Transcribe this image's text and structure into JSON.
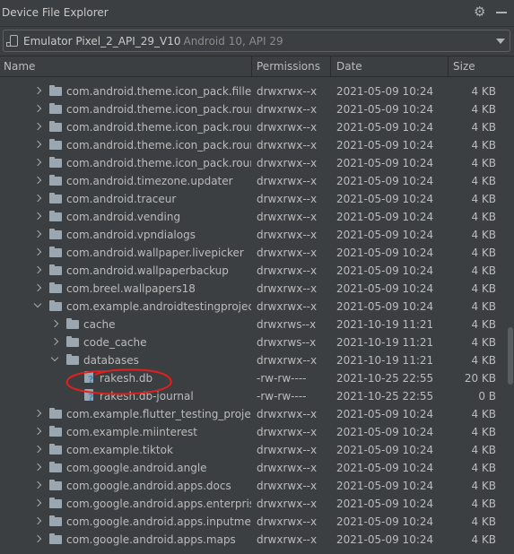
{
  "title": "Device File Explorer",
  "icons": {
    "settings": "gear-icon",
    "hide": "minimize-icon",
    "device": "phone-icon",
    "dropdown": "chevron-down-icon"
  },
  "device": {
    "name": "Emulator Pixel_2_API_29_V10",
    "detail": "Android 10, API 29"
  },
  "columns": {
    "name": "Name",
    "permissions": "Permissions",
    "date": "Date",
    "size": "Size"
  },
  "colors": {
    "annotation": "#e0201f",
    "folder": "#9aa7b0",
    "question_badge": "#3592c4"
  },
  "rows": [
    {
      "name": "com.android.theme.icon_pack.filled.themepicker",
      "perm": "drwxrwx--x",
      "date": "2021-05-09 10:24",
      "size": "4 KB",
      "depth": 0,
      "type": "folder",
      "state": "collapsed"
    },
    {
      "name": "com.android.theme.icon_pack.rounded.android",
      "perm": "drwxrwx--x",
      "date": "2021-05-09 10:24",
      "size": "4 KB",
      "depth": 0,
      "type": "folder",
      "state": "collapsed"
    },
    {
      "name": "com.android.theme.icon_pack.rounded.launcher",
      "perm": "drwxrwx--x",
      "date": "2021-05-09 10:24",
      "size": "4 KB",
      "depth": 0,
      "type": "folder",
      "state": "collapsed"
    },
    {
      "name": "com.android.theme.icon_pack.rounded.settings",
      "perm": "drwxrwx--x",
      "date": "2021-05-09 10:24",
      "size": "4 KB",
      "depth": 0,
      "type": "folder",
      "state": "collapsed"
    },
    {
      "name": "com.android.theme.icon_pack.rounded.systemui",
      "perm": "drwxrwx--x",
      "date": "2021-05-09 10:24",
      "size": "4 KB",
      "depth": 0,
      "type": "folder",
      "state": "collapsed"
    },
    {
      "name": "com.android.timezone.updater",
      "perm": "drwxrwx--x",
      "date": "2021-05-09 10:24",
      "size": "4 KB",
      "depth": 0,
      "type": "folder",
      "state": "collapsed"
    },
    {
      "name": "com.android.traceur",
      "perm": "drwxrwx--x",
      "date": "2021-05-09 10:24",
      "size": "4 KB",
      "depth": 0,
      "type": "folder",
      "state": "collapsed"
    },
    {
      "name": "com.android.vending",
      "perm": "drwxrwx--x",
      "date": "2021-05-09 10:24",
      "size": "4 KB",
      "depth": 0,
      "type": "folder",
      "state": "collapsed"
    },
    {
      "name": "com.android.vpndialogs",
      "perm": "drwxrwx--x",
      "date": "2021-05-09 10:24",
      "size": "4 KB",
      "depth": 0,
      "type": "folder",
      "state": "collapsed"
    },
    {
      "name": "com.android.wallpaper.livepicker",
      "perm": "drwxrwx--x",
      "date": "2021-05-09 10:24",
      "size": "4 KB",
      "depth": 0,
      "type": "folder",
      "state": "collapsed"
    },
    {
      "name": "com.android.wallpaperbackup",
      "perm": "drwxrwx--x",
      "date": "2021-05-09 10:24",
      "size": "4 KB",
      "depth": 0,
      "type": "folder",
      "state": "collapsed"
    },
    {
      "name": "com.breel.wallpapers18",
      "perm": "drwxrwx--x",
      "date": "2021-05-09 10:24",
      "size": "4 KB",
      "depth": 0,
      "type": "folder",
      "state": "collapsed"
    },
    {
      "name": "com.example.androidtestingproject",
      "perm": "drwxrwx--x",
      "date": "2021-05-09 10:24",
      "size": "4 KB",
      "depth": 0,
      "type": "folder",
      "state": "expanded"
    },
    {
      "name": "cache",
      "perm": "drwxrws--x",
      "date": "2021-10-19 11:21",
      "size": "4 KB",
      "depth": 1,
      "type": "folder",
      "state": "collapsed"
    },
    {
      "name": "code_cache",
      "perm": "drwxrws--x",
      "date": "2021-10-19 11:21",
      "size": "4 KB",
      "depth": 1,
      "type": "folder",
      "state": "collapsed"
    },
    {
      "name": "databases",
      "perm": "drwxrwx--x",
      "date": "2021-10-19 11:21",
      "size": "4 KB",
      "depth": 1,
      "type": "folder",
      "state": "expanded"
    },
    {
      "name": "rakesh.db",
      "perm": "-rw-rw----",
      "date": "2021-10-25 22:55",
      "size": "20 KB",
      "depth": 2,
      "type": "file",
      "state": "none",
      "circled": true
    },
    {
      "name": "rakesh.db-journal",
      "perm": "-rw-rw----",
      "date": "2021-10-25 22:55",
      "size": "0 B",
      "depth": 2,
      "type": "file",
      "state": "none"
    },
    {
      "name": "com.example.flutter_testing_project",
      "perm": "drwxrwx--x",
      "date": "2021-05-09 10:24",
      "size": "4 KB",
      "depth": 0,
      "type": "folder",
      "state": "collapsed"
    },
    {
      "name": "com.example.miinterest",
      "perm": "drwxrwx--x",
      "date": "2021-05-09 10:24",
      "size": "4 KB",
      "depth": 0,
      "type": "folder",
      "state": "collapsed"
    },
    {
      "name": "com.example.tiktok",
      "perm": "drwxrwx--x",
      "date": "2021-05-09 10:24",
      "size": "4 KB",
      "depth": 0,
      "type": "folder",
      "state": "collapsed"
    },
    {
      "name": "com.google.android.angle",
      "perm": "drwxrwx--x",
      "date": "2021-05-09 10:24",
      "size": "4 KB",
      "depth": 0,
      "type": "folder",
      "state": "collapsed"
    },
    {
      "name": "com.google.android.apps.docs",
      "perm": "drwxrwx--x",
      "date": "2021-05-09 10:24",
      "size": "4 KB",
      "depth": 0,
      "type": "folder",
      "state": "collapsed"
    },
    {
      "name": "com.google.android.apps.enterprise.dmagent",
      "perm": "drwxrwx--x",
      "date": "2021-05-09 10:24",
      "size": "4 KB",
      "depth": 0,
      "type": "folder",
      "state": "collapsed"
    },
    {
      "name": "com.google.android.apps.inputmethod.hindi",
      "perm": "drwxrwx--x",
      "date": "2021-05-09 10:24",
      "size": "4 KB",
      "depth": 0,
      "type": "folder",
      "state": "collapsed"
    },
    {
      "name": "com.google.android.apps.maps",
      "perm": "drwxrwx--x",
      "date": "2021-05-09 10:24",
      "size": "4 KB",
      "depth": 0,
      "type": "folder",
      "state": "collapsed"
    }
  ]
}
